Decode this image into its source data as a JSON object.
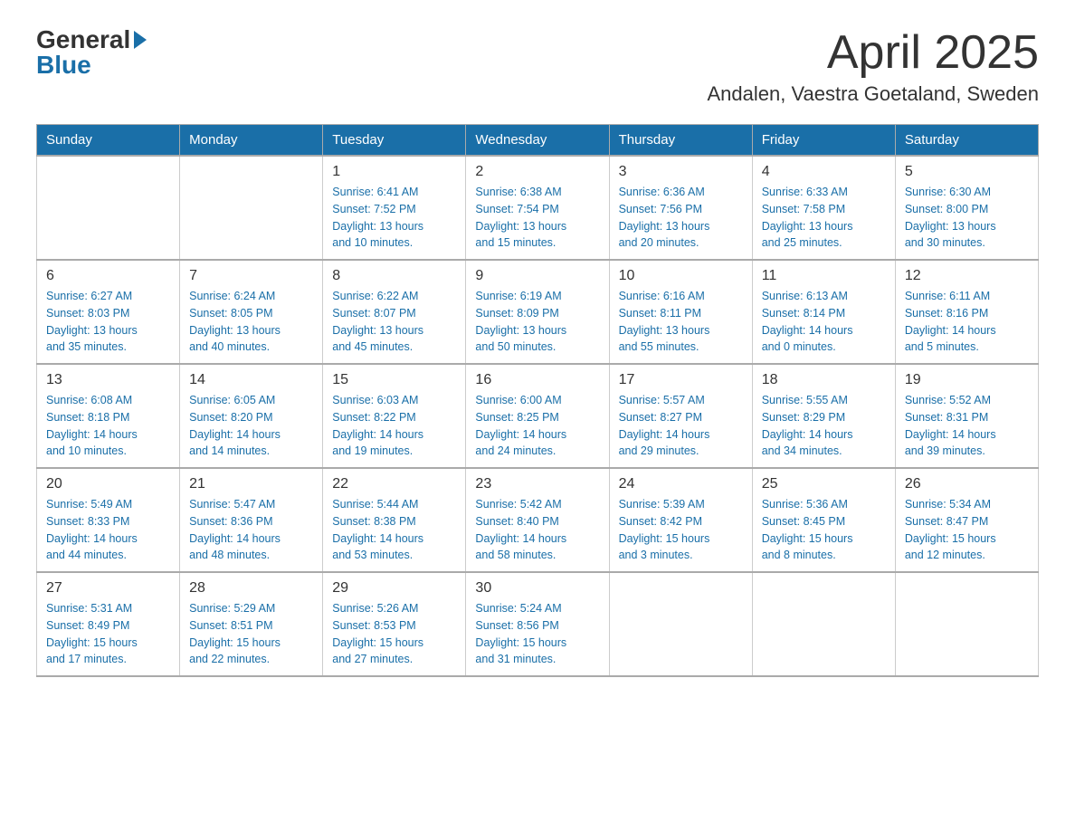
{
  "header": {
    "logo_general": "General",
    "logo_blue": "Blue",
    "month_title": "April 2025",
    "location": "Andalen, Vaestra Goetaland, Sweden"
  },
  "calendar": {
    "days_of_week": [
      "Sunday",
      "Monday",
      "Tuesday",
      "Wednesday",
      "Thursday",
      "Friday",
      "Saturday"
    ],
    "weeks": [
      [
        {
          "day": "",
          "info": ""
        },
        {
          "day": "",
          "info": ""
        },
        {
          "day": "1",
          "info": "Sunrise: 6:41 AM\nSunset: 7:52 PM\nDaylight: 13 hours\nand 10 minutes."
        },
        {
          "day": "2",
          "info": "Sunrise: 6:38 AM\nSunset: 7:54 PM\nDaylight: 13 hours\nand 15 minutes."
        },
        {
          "day": "3",
          "info": "Sunrise: 6:36 AM\nSunset: 7:56 PM\nDaylight: 13 hours\nand 20 minutes."
        },
        {
          "day": "4",
          "info": "Sunrise: 6:33 AM\nSunset: 7:58 PM\nDaylight: 13 hours\nand 25 minutes."
        },
        {
          "day": "5",
          "info": "Sunrise: 6:30 AM\nSunset: 8:00 PM\nDaylight: 13 hours\nand 30 minutes."
        }
      ],
      [
        {
          "day": "6",
          "info": "Sunrise: 6:27 AM\nSunset: 8:03 PM\nDaylight: 13 hours\nand 35 minutes."
        },
        {
          "day": "7",
          "info": "Sunrise: 6:24 AM\nSunset: 8:05 PM\nDaylight: 13 hours\nand 40 minutes."
        },
        {
          "day": "8",
          "info": "Sunrise: 6:22 AM\nSunset: 8:07 PM\nDaylight: 13 hours\nand 45 minutes."
        },
        {
          "day": "9",
          "info": "Sunrise: 6:19 AM\nSunset: 8:09 PM\nDaylight: 13 hours\nand 50 minutes."
        },
        {
          "day": "10",
          "info": "Sunrise: 6:16 AM\nSunset: 8:11 PM\nDaylight: 13 hours\nand 55 minutes."
        },
        {
          "day": "11",
          "info": "Sunrise: 6:13 AM\nSunset: 8:14 PM\nDaylight: 14 hours\nand 0 minutes."
        },
        {
          "day": "12",
          "info": "Sunrise: 6:11 AM\nSunset: 8:16 PM\nDaylight: 14 hours\nand 5 minutes."
        }
      ],
      [
        {
          "day": "13",
          "info": "Sunrise: 6:08 AM\nSunset: 8:18 PM\nDaylight: 14 hours\nand 10 minutes."
        },
        {
          "day": "14",
          "info": "Sunrise: 6:05 AM\nSunset: 8:20 PM\nDaylight: 14 hours\nand 14 minutes."
        },
        {
          "day": "15",
          "info": "Sunrise: 6:03 AM\nSunset: 8:22 PM\nDaylight: 14 hours\nand 19 minutes."
        },
        {
          "day": "16",
          "info": "Sunrise: 6:00 AM\nSunset: 8:25 PM\nDaylight: 14 hours\nand 24 minutes."
        },
        {
          "day": "17",
          "info": "Sunrise: 5:57 AM\nSunset: 8:27 PM\nDaylight: 14 hours\nand 29 minutes."
        },
        {
          "day": "18",
          "info": "Sunrise: 5:55 AM\nSunset: 8:29 PM\nDaylight: 14 hours\nand 34 minutes."
        },
        {
          "day": "19",
          "info": "Sunrise: 5:52 AM\nSunset: 8:31 PM\nDaylight: 14 hours\nand 39 minutes."
        }
      ],
      [
        {
          "day": "20",
          "info": "Sunrise: 5:49 AM\nSunset: 8:33 PM\nDaylight: 14 hours\nand 44 minutes."
        },
        {
          "day": "21",
          "info": "Sunrise: 5:47 AM\nSunset: 8:36 PM\nDaylight: 14 hours\nand 48 minutes."
        },
        {
          "day": "22",
          "info": "Sunrise: 5:44 AM\nSunset: 8:38 PM\nDaylight: 14 hours\nand 53 minutes."
        },
        {
          "day": "23",
          "info": "Sunrise: 5:42 AM\nSunset: 8:40 PM\nDaylight: 14 hours\nand 58 minutes."
        },
        {
          "day": "24",
          "info": "Sunrise: 5:39 AM\nSunset: 8:42 PM\nDaylight: 15 hours\nand 3 minutes."
        },
        {
          "day": "25",
          "info": "Sunrise: 5:36 AM\nSunset: 8:45 PM\nDaylight: 15 hours\nand 8 minutes."
        },
        {
          "day": "26",
          "info": "Sunrise: 5:34 AM\nSunset: 8:47 PM\nDaylight: 15 hours\nand 12 minutes."
        }
      ],
      [
        {
          "day": "27",
          "info": "Sunrise: 5:31 AM\nSunset: 8:49 PM\nDaylight: 15 hours\nand 17 minutes."
        },
        {
          "day": "28",
          "info": "Sunrise: 5:29 AM\nSunset: 8:51 PM\nDaylight: 15 hours\nand 22 minutes."
        },
        {
          "day": "29",
          "info": "Sunrise: 5:26 AM\nSunset: 8:53 PM\nDaylight: 15 hours\nand 27 minutes."
        },
        {
          "day": "30",
          "info": "Sunrise: 5:24 AM\nSunset: 8:56 PM\nDaylight: 15 hours\nand 31 minutes."
        },
        {
          "day": "",
          "info": ""
        },
        {
          "day": "",
          "info": ""
        },
        {
          "day": "",
          "info": ""
        }
      ]
    ]
  }
}
